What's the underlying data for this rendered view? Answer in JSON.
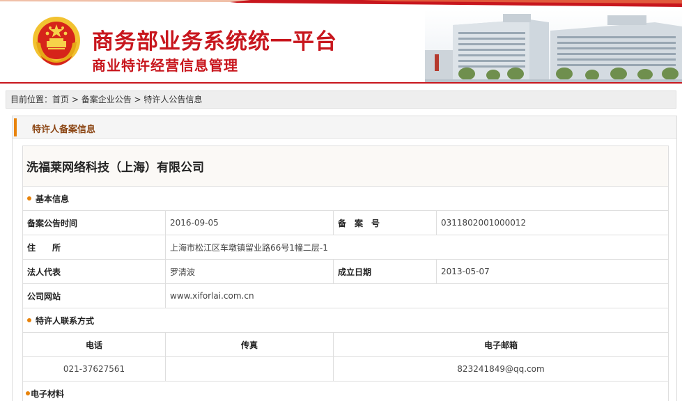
{
  "header": {
    "title": "商务部业务系统统一平台",
    "subtitle": "商业特许经营信息管理",
    "emblem_icon": "national-emblem-icon",
    "colors": {
      "brand_red": "#c8161d",
      "gold": "#f2c230"
    }
  },
  "breadcrumb": {
    "prefix": "目前位置：",
    "home": "首页",
    "sep": " > ",
    "level2": "备案企业公告",
    "current": "特许人公告信息"
  },
  "panel": {
    "title": "特许人备案信息",
    "accent_color": "#e8830b"
  },
  "company": {
    "name": "洗福莱网络科技（上海）有限公司"
  },
  "basic": {
    "section_title": "基本信息",
    "announce_date_label": "备案公告时间",
    "announce_date": "2016-09-05",
    "record_no_label": "备　案　号",
    "record_no": "0311802001000012",
    "address_label": "住　　所",
    "address": "上海市松江区车墩镇留业路66号1幢二层-1",
    "legal_rep_label": "法人代表",
    "legal_rep": "罗清波",
    "founded_label": "成立日期",
    "founded": "2013-05-07",
    "website_label": "公司网站",
    "website": "www.xiforlai.com.cn"
  },
  "contact": {
    "section_title": "特许人联系方式",
    "phone_header": "电话",
    "fax_header": "传真",
    "email_header": "电子邮箱",
    "phone": "021-37627561",
    "fax": "",
    "email": "823241849@qq.com"
  },
  "materials": {
    "section_title": "电子材料"
  }
}
